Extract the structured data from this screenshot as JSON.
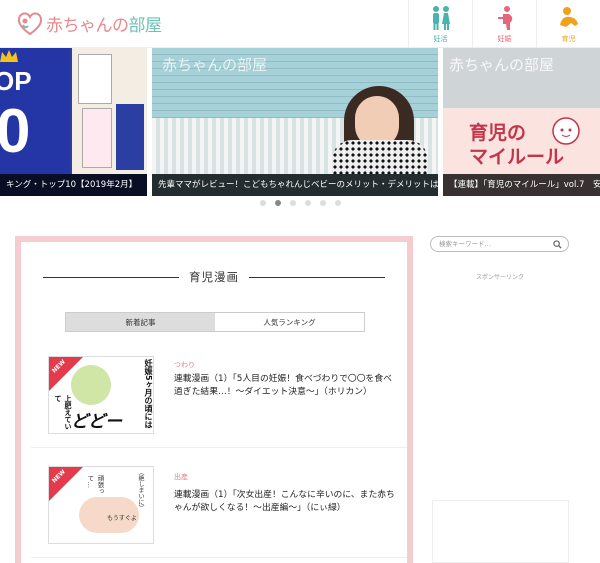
{
  "header": {
    "logo_text_a": "赤ちゃんの",
    "logo_text_b": "部屋",
    "nav": [
      {
        "label": "妊活",
        "icon": "couple-icon",
        "color": "#48b4ad"
      },
      {
        "label": "妊娠",
        "icon": "pregnancy-icon",
        "color": "#e6677c"
      },
      {
        "label": "育児",
        "icon": "baby-icon",
        "color": "#f1a11c"
      }
    ]
  },
  "carousel": {
    "slides": [
      {
        "caption": "キング・トップ10【2019年2月】",
        "badge": "OP",
        "badge_num": "0"
      },
      {
        "caption": "先輩ママがレビュー！こどもちゃれんじベビーのメリット・デメリットは？",
        "watermark": "赤ちゃんの部屋"
      },
      {
        "caption": "【連載】「育児のマイルール」vol.7　安",
        "watermark": "赤ちゃんの部屋",
        "title_line1": "育児の",
        "title_line2": "マイルール"
      }
    ],
    "active_index": 1,
    "dot_count": 6
  },
  "main": {
    "section_title": "育児漫画",
    "tabs": [
      {
        "label": "新着記事",
        "active": true
      },
      {
        "label": "人気ランキング",
        "active": false
      }
    ],
    "articles": [
      {
        "category": "つわり",
        "title": "連載漫画（1）「5人目の妊娠！食べづわりで〇〇を食べ過ぎた結果…！～ダイエット決意～」（ホリカン）",
        "badge": "NEW",
        "thumb_text_a": "妊娠5ヶ月の頃には",
        "thumb_text_b": "どどーん!!",
        "thumb_text_c": "上肥えていて"
      },
      {
        "category": "出産",
        "title": "連載漫画（1）「次女出産！こんなに辛いのに、また赤ちゃんが欲しくなる！～出産編～」（にぃ緑）",
        "badge": "NEW",
        "thumb_text_a": "（絶しまいに）",
        "thumb_text_b": "頑張って…",
        "thumb_text_c": "もうすぐよ"
      }
    ]
  },
  "sidebar": {
    "search_placeholder": "検索キーワード…",
    "sponsor_label": "スポンサーリンク"
  }
}
